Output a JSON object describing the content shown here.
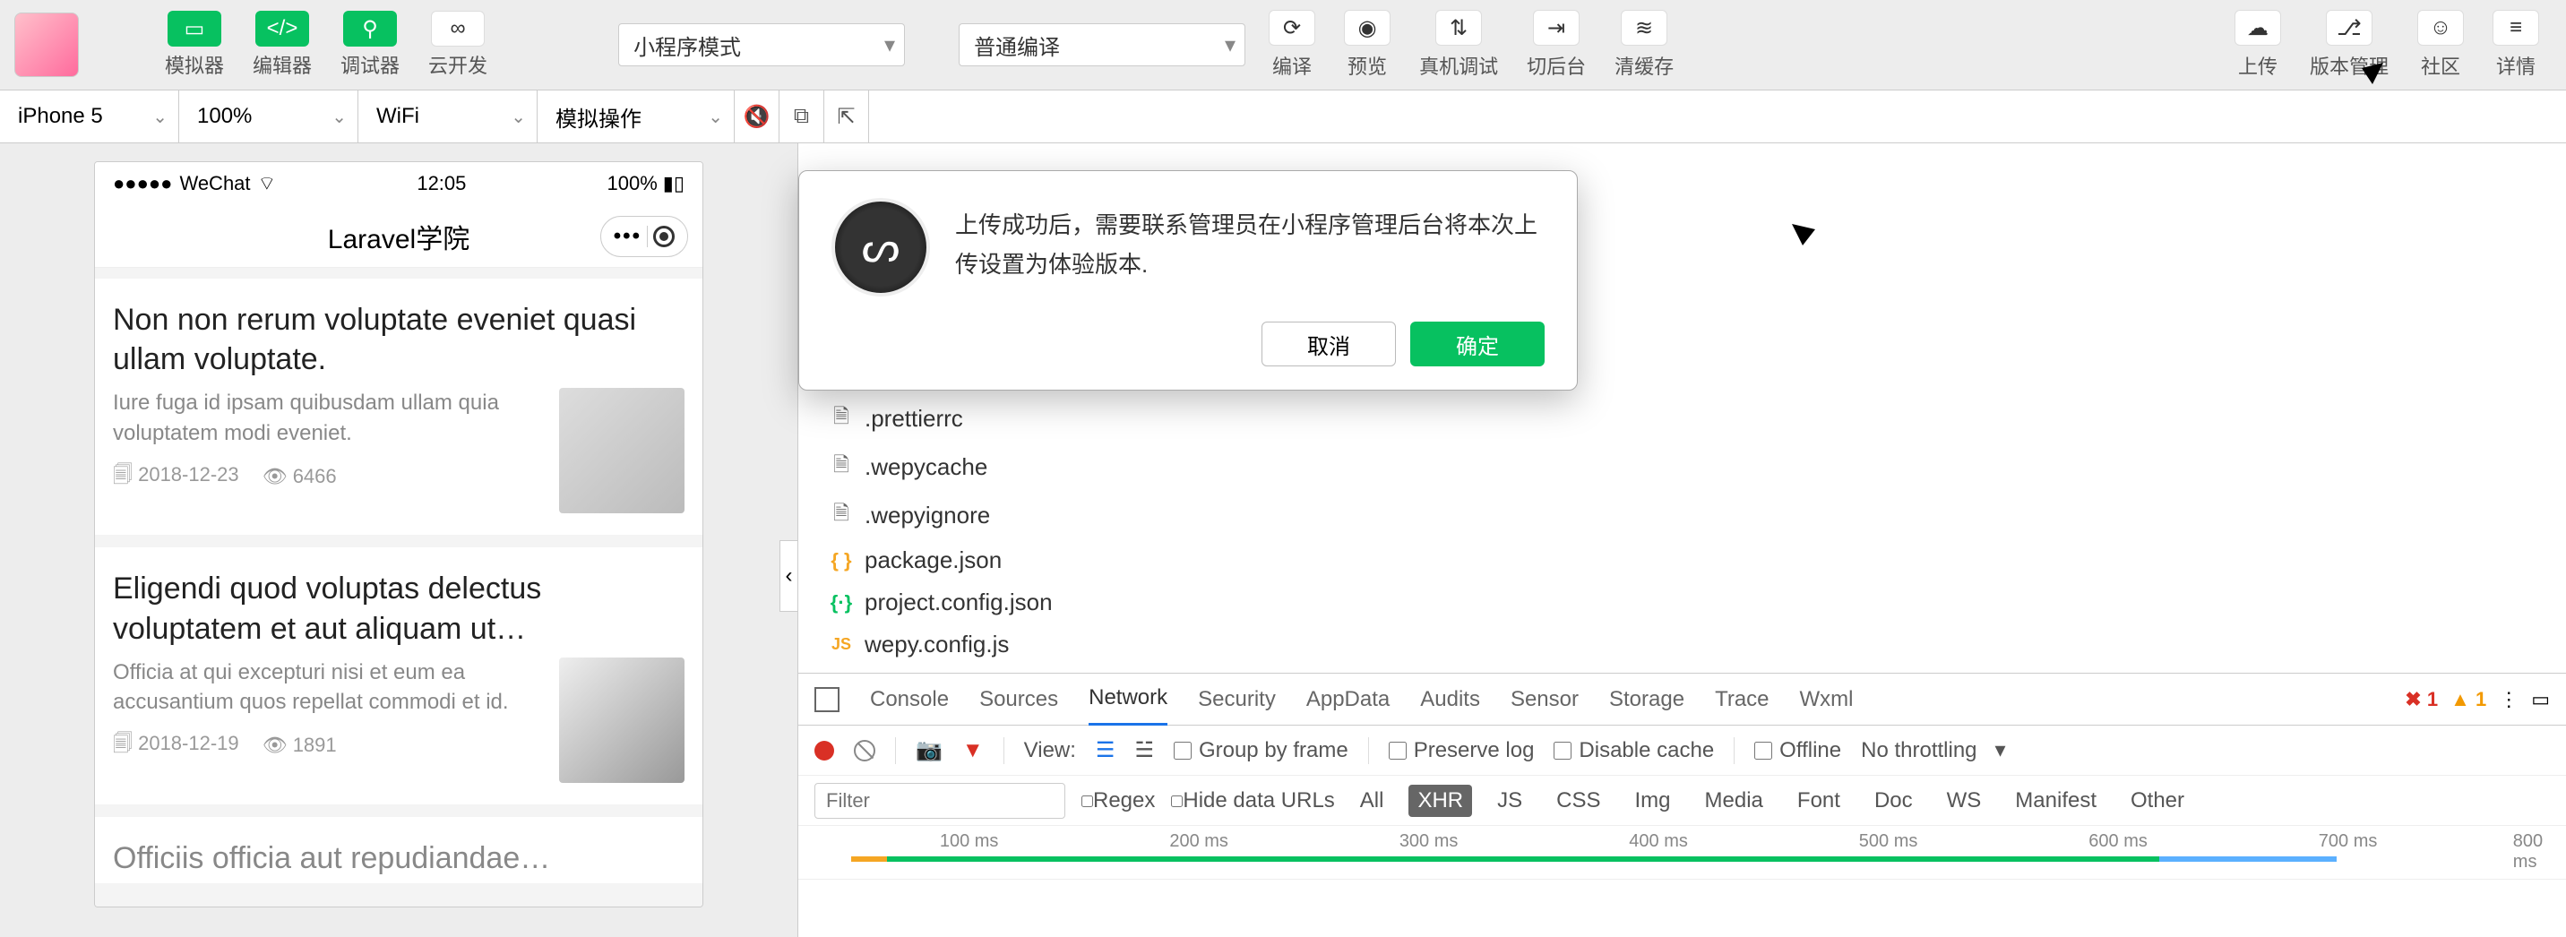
{
  "toolbar": {
    "simulator": "模拟器",
    "editor": "编辑器",
    "debugger": "调试器",
    "cloud": "云开发",
    "mode": "小程序模式",
    "compile_mode": "普通编译",
    "compile": "编译",
    "preview": "预览",
    "remote_debug": "真机调试",
    "background": "切后台",
    "clear_cache": "清缓存",
    "upload": "上传",
    "version": "版本管理",
    "community": "社区",
    "details": "详情"
  },
  "second_bar": {
    "device": "iPhone 5",
    "zoom": "100%",
    "network": "WiFi",
    "sim_ops": "模拟操作"
  },
  "phone": {
    "carrier": "WeChat",
    "time": "12:05",
    "battery": "100%",
    "app_title": "Laravel学院",
    "cards": [
      {
        "title": "Non non rerum voluptate eveniet quasi ullam voluptate.",
        "desc": "Iure fuga id ipsam quibusdam ullam quia voluptatem modi eveniet.",
        "date": "2018-12-23",
        "views": "6466"
      },
      {
        "title": "Eligendi quod voluptas delectus voluptatem et aut aliquam ut…",
        "desc": "Officia at qui excepturi nisi et eum ea accusantium quos repellat commodi et id.",
        "date": "2018-12-19",
        "views": "1891"
      },
      {
        "title": "Officiis officia aut repudiandae…"
      }
    ]
  },
  "files": [
    {
      "name": ".prettierrc",
      "icon": "doc"
    },
    {
      "name": ".wepycache",
      "icon": "doc"
    },
    {
      "name": ".wepyignore",
      "icon": "doc"
    },
    {
      "name": "package.json",
      "icon": "json"
    },
    {
      "name": "project.config.json",
      "icon": "json2"
    },
    {
      "name": "wepy.config.js",
      "icon": "js"
    }
  ],
  "modal": {
    "message": "上传成功后，需要联系管理员在小程序管理后台将本次上传设置为体验版本.",
    "cancel": "取消",
    "ok": "确定"
  },
  "devtools": {
    "tabs": [
      "Console",
      "Sources",
      "Network",
      "Security",
      "AppData",
      "Audits",
      "Sensor",
      "Storage",
      "Trace",
      "Wxml"
    ],
    "active_tab": "Network",
    "errors": "1",
    "warnings": "1",
    "view_label": "View:",
    "group_by_frame": "Group by frame",
    "preserve_log": "Preserve log",
    "disable_cache": "Disable cache",
    "offline": "Offline",
    "throttling": "No throttling",
    "filter_placeholder": "Filter",
    "regex": "Regex",
    "hide_data_urls": "Hide data URLs",
    "filter_types": [
      "All",
      "XHR",
      "JS",
      "CSS",
      "Img",
      "Media",
      "Font",
      "Doc",
      "WS",
      "Manifest",
      "Other"
    ],
    "active_filter": "XHR",
    "timeline_ticks": [
      "100 ms",
      "200 ms",
      "300 ms",
      "400 ms",
      "500 ms",
      "600 ms",
      "700 ms",
      "800 ms"
    ]
  }
}
